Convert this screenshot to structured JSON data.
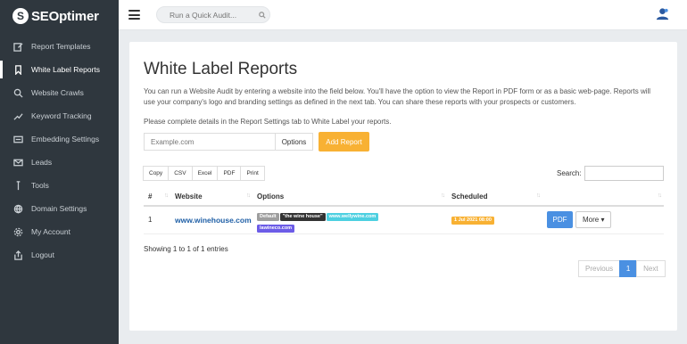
{
  "brand": {
    "name": "SEOptimer"
  },
  "sidebar": {
    "items": [
      {
        "label": "Report Templates",
        "icon": "edit-icon",
        "active": false
      },
      {
        "label": "White Label Reports",
        "icon": "bookmark-icon",
        "active": true
      },
      {
        "label": "Website Crawls",
        "icon": "search-icon",
        "active": false
      },
      {
        "label": "Keyword Tracking",
        "icon": "trend-icon",
        "active": false
      },
      {
        "label": "Embedding Settings",
        "icon": "embed-icon",
        "active": false
      },
      {
        "label": "Leads",
        "icon": "mail-icon",
        "active": false
      },
      {
        "label": "Tools",
        "icon": "wrench-icon",
        "active": false
      },
      {
        "label": "Domain Settings",
        "icon": "globe-icon",
        "active": false
      },
      {
        "label": "My Account",
        "icon": "gear-icon",
        "active": false
      },
      {
        "label": "Logout",
        "icon": "logout-icon",
        "active": false
      }
    ]
  },
  "topbar": {
    "quick_audit_placeholder": "Run a Quick Audit..."
  },
  "main": {
    "title": "White Label Reports",
    "description": "You can run a Website Audit by entering a website into the field below. You'll have the option to view the Report in PDF form or as a basic web-page. Reports will use your company's logo and branding settings as defined in the next tab. You can share these reports with your prospects or customers.",
    "instructions": "Please complete details in the Report Settings tab to White Label your reports.",
    "website_placeholder": "Example.com",
    "options_label": "Options",
    "add_report_label": "Add Report",
    "export_buttons": [
      "Copy",
      "CSV",
      "Excel",
      "PDF",
      "Print"
    ],
    "search_label": "Search:",
    "table": {
      "headers": [
        "#",
        "Website",
        "Options",
        "Scheduled",
        ""
      ],
      "rows": [
        {
          "num": "1",
          "website": "www.winehouse.com",
          "badges": [
            {
              "text": "Default",
              "color": "#9e9e9e"
            },
            {
              "text": "\"the wine house\"",
              "color": "#333333"
            },
            {
              "text": "www.wellywine.com",
              "color": "#4dd0e1"
            },
            {
              "text": "lawineco.com",
              "color": "#6c5ce7"
            }
          ],
          "scheduled": "1 Jul 2021 08:00",
          "scheduled_color": "#f8b133",
          "pdf_label": "PDF",
          "more_label": "More ▾"
        }
      ]
    },
    "entries_info": "Showing 1 to 1 of 1 entries",
    "pagination": {
      "previous": "Previous",
      "current": "1",
      "next": "Next"
    }
  },
  "colors": {
    "sidebar_bg": "#2f373e",
    "accent_orange": "#f8b133",
    "primary_blue": "#4a90e2",
    "link_blue": "#1f5fa6"
  }
}
